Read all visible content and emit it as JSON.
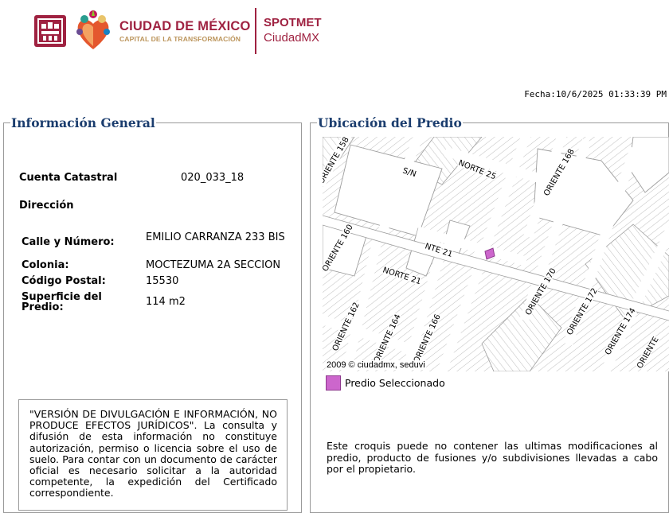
{
  "header": {
    "brand_name": "CIUDAD DE MÉXICO",
    "brand_sub": "CAPITAL DE LA TRANSFORMACIÓN",
    "app_name": "SPOTMET",
    "app_sub": "CiudadMX",
    "colors": {
      "primary": "#9f2241",
      "gold": "#bc955c"
    }
  },
  "fecha": "Fecha:10/6/2025 01:33:39 PM",
  "info": {
    "legend": "Información General",
    "cuenta_label": "Cuenta Catastral",
    "cuenta_value": "020_033_18",
    "direccion_label": "Dirección",
    "rows": [
      {
        "label": "Calle y Número:",
        "value": "EMILIO CARRANZA 233 BIS"
      },
      {
        "label": "Colonia:",
        "value": "MOCTEZUMA 2A SECCION"
      },
      {
        "label": "Código Postal:",
        "value": "15530"
      },
      {
        "label": "Superficie del Predio:",
        "value": "114 m2"
      }
    ],
    "disclaimer": "\"VERSIÓN DE DIVULGACIÓN E INFORMACIÓN, NO PRODUCE EFECTOS JURÍDICOS\". La consulta y difusión de esta información no constituye autorización, permiso o licencia sobre el uso de suelo. Para contar con un documento de carácter oficial es necesario solicitar a la autoridad competente, la expedición del Certificado correspondiente."
  },
  "map": {
    "legend": "Ubicación del Predio",
    "streets": [
      "ORIENTE 158",
      "S/N",
      "NORTE 25",
      "ORIENTE 168",
      "ORIENTE 160",
      "NTE 21",
      "NORTE 21",
      "ORIENTE 170",
      "ORIENTE 162",
      "ORIENTE 164",
      "ORIENTE 166",
      "ORIENTE 172",
      "ORIENTE 174",
      "ORIENTE"
    ],
    "credit": "2009 © ciudadmx, seduvi",
    "legend_label": "Predio Seleccionado",
    "selected_color": "#cc66cc",
    "note": "Este croquis puede no contener las ultimas modificaciones al predio, producto de fusiones y/o subdivisiones llevadas a cabo por el propietario."
  }
}
